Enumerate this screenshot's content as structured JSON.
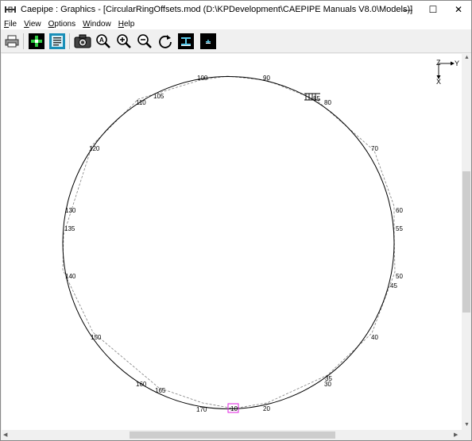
{
  "window": {
    "title": "Caepipe : Graphics - [CircularRingOffsets.mod (D:\\KPDevelopment\\CAEPIPE Manuals V8.0\\Models)]",
    "controls": {
      "minimize": "—",
      "maximize": "☐",
      "close": "✕"
    }
  },
  "menu": {
    "items": [
      {
        "key": "F",
        "rest": "ile"
      },
      {
        "key": "V",
        "rest": "iew"
      },
      {
        "key": "O",
        "rest": "ptions"
      },
      {
        "key": "W",
        "rest": "indow"
      },
      {
        "key": "H",
        "rest": "elp"
      }
    ]
  },
  "toolbar": {
    "buttons": [
      "print-icon",
      "plot-model-icon",
      "list-icon",
      "camera-icon",
      "zoom-all-icon",
      "zoom-in-icon",
      "zoom-out-icon",
      "rotate-icon",
      "render-beam-icon",
      "render-small-icon"
    ]
  },
  "axes": {
    "z": "Z",
    "y": "Y",
    "x": "X"
  },
  "nodes": {
    "n90": "90",
    "n100": "100",
    "n105": "105",
    "n110": "110",
    "n85": "85",
    "n80": "80",
    "n70": "70",
    "n120": "120",
    "n60": "60",
    "n130": "130",
    "n55": "55",
    "n135": "135",
    "n50": "50",
    "n45": "45",
    "n140": "140",
    "n40": "40",
    "n150": "150",
    "n35": "35",
    "n30": "30",
    "n160": "160",
    "n165": "165",
    "n170": "170",
    "n10": "10",
    "n20": "20"
  },
  "colors": {
    "selected_node": "#e020e0",
    "line": "#000000",
    "offset_line": "#808080"
  }
}
